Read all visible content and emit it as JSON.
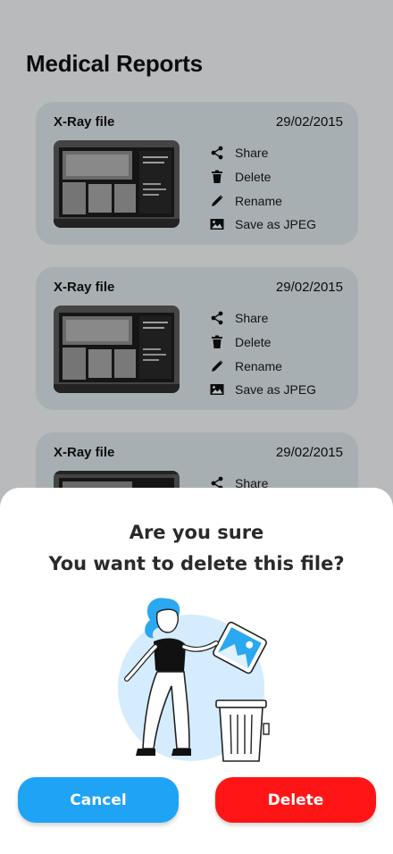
{
  "header": {
    "title": "Medical Reports"
  },
  "reports": [
    {
      "name": "X-Ray file",
      "date": "29/02/2015",
      "actions": [
        {
          "icon": "share-icon",
          "label": "Share"
        },
        {
          "icon": "trash-icon",
          "label": "Delete"
        },
        {
          "icon": "pencil-icon",
          "label": "Rename"
        },
        {
          "icon": "image-icon",
          "label": "Save as JPEG"
        }
      ]
    },
    {
      "name": "X-Ray file",
      "date": "29/02/2015",
      "actions": [
        {
          "icon": "share-icon",
          "label": "Share"
        },
        {
          "icon": "trash-icon",
          "label": "Delete"
        },
        {
          "icon": "pencil-icon",
          "label": "Rename"
        },
        {
          "icon": "image-icon",
          "label": "Save as JPEG"
        }
      ]
    },
    {
      "name": "X-Ray file",
      "date": "29/02/2015",
      "actions": [
        {
          "icon": "share-icon",
          "label": "Share"
        }
      ]
    }
  ],
  "dialog": {
    "question_line1": "Are you sure",
    "question_line2": "You want to delete this file?",
    "illustration": "person-throwing-photo-in-trash-illustration",
    "cancel_label": "Cancel",
    "delete_label": "Delete"
  },
  "colors": {
    "card_bg": "#dde7ea",
    "cancel_button": "#1fa3f5",
    "delete_button": "#ff1515",
    "illustration_accent": "#2aa8f0"
  }
}
